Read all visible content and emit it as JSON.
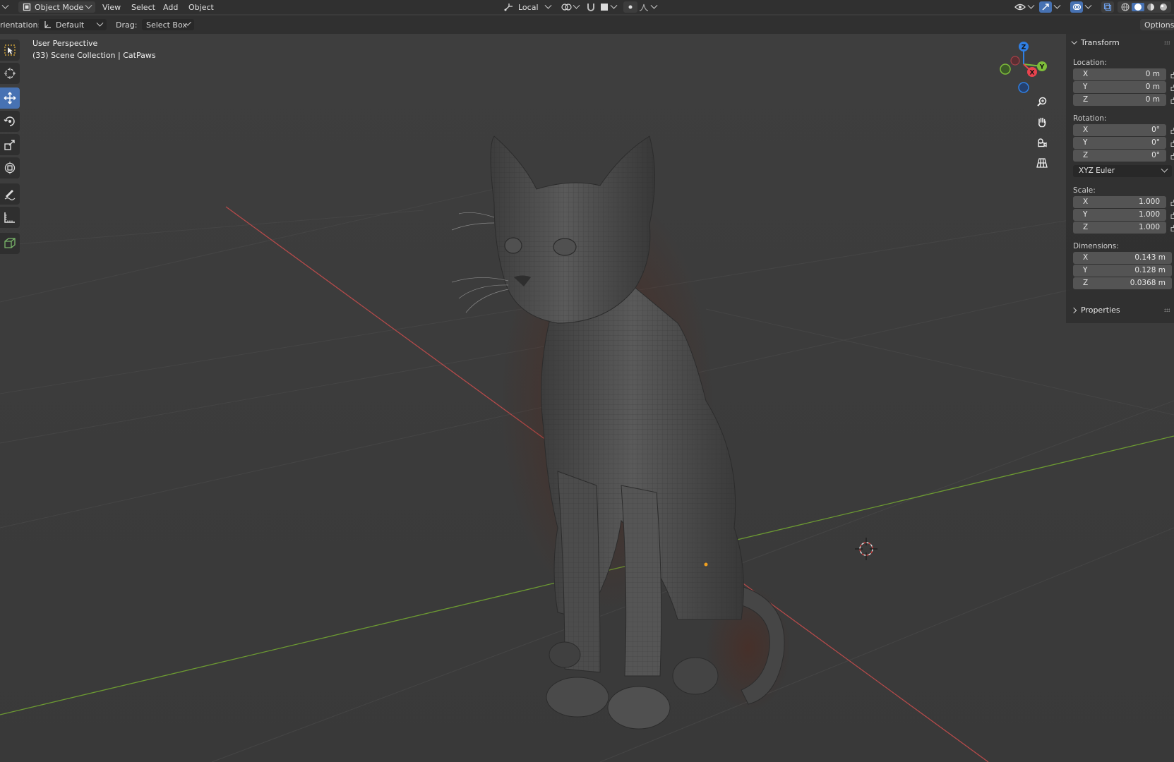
{
  "header": {
    "mode": "Object Mode",
    "menus": [
      "View",
      "Select",
      "Add",
      "Object"
    ],
    "transform_pivot": "Local"
  },
  "tool_settings": {
    "orientation_label": "rientation:",
    "orientation_value": "Default",
    "drag_label": "Drag:",
    "drag_value": "Select Box",
    "options_label": "Options"
  },
  "viewport": {
    "perspective": "User Perspective",
    "collection": "(33) Scene Collection | CatPaws"
  },
  "gizmo": {
    "x_label": "X",
    "y_label": "Y",
    "z_label": "Z",
    "x_color": "#e9434e",
    "y_color": "#7ebd3a",
    "z_color": "#2f7fe4"
  },
  "sidebar": {
    "transform_title": "Transform",
    "location_label": "Location:",
    "location": [
      {
        "axis": "X",
        "value": "0 m"
      },
      {
        "axis": "Y",
        "value": "0 m"
      },
      {
        "axis": "Z",
        "value": "0 m"
      }
    ],
    "rotation_label": "Rotation:",
    "rotation": [
      {
        "axis": "X",
        "value": "0°"
      },
      {
        "axis": "Y",
        "value": "0°"
      },
      {
        "axis": "Z",
        "value": "0°"
      }
    ],
    "rotation_mode": "XYZ Euler",
    "scale_label": "Scale:",
    "scale": [
      {
        "axis": "X",
        "value": "1.000"
      },
      {
        "axis": "Y",
        "value": "1.000"
      },
      {
        "axis": "Z",
        "value": "1.000"
      }
    ],
    "dimensions_label": "Dimensions:",
    "dimensions": [
      {
        "axis": "X",
        "value": "0.143 m"
      },
      {
        "axis": "Y",
        "value": "0.128 m"
      },
      {
        "axis": "Z",
        "value": "0.0368 m"
      }
    ],
    "properties_title": "Properties"
  },
  "tools": [
    "select-box-icon",
    "cursor-icon",
    "move-icon",
    "rotate-icon",
    "scale-icon",
    "transform-icon",
    "annotate-icon",
    "measure-icon",
    "add-cube-icon"
  ],
  "colors": {
    "accent": "#4772b3",
    "x_axis_line": "#b54a4a",
    "y_axis_line": "#6c9a32"
  }
}
